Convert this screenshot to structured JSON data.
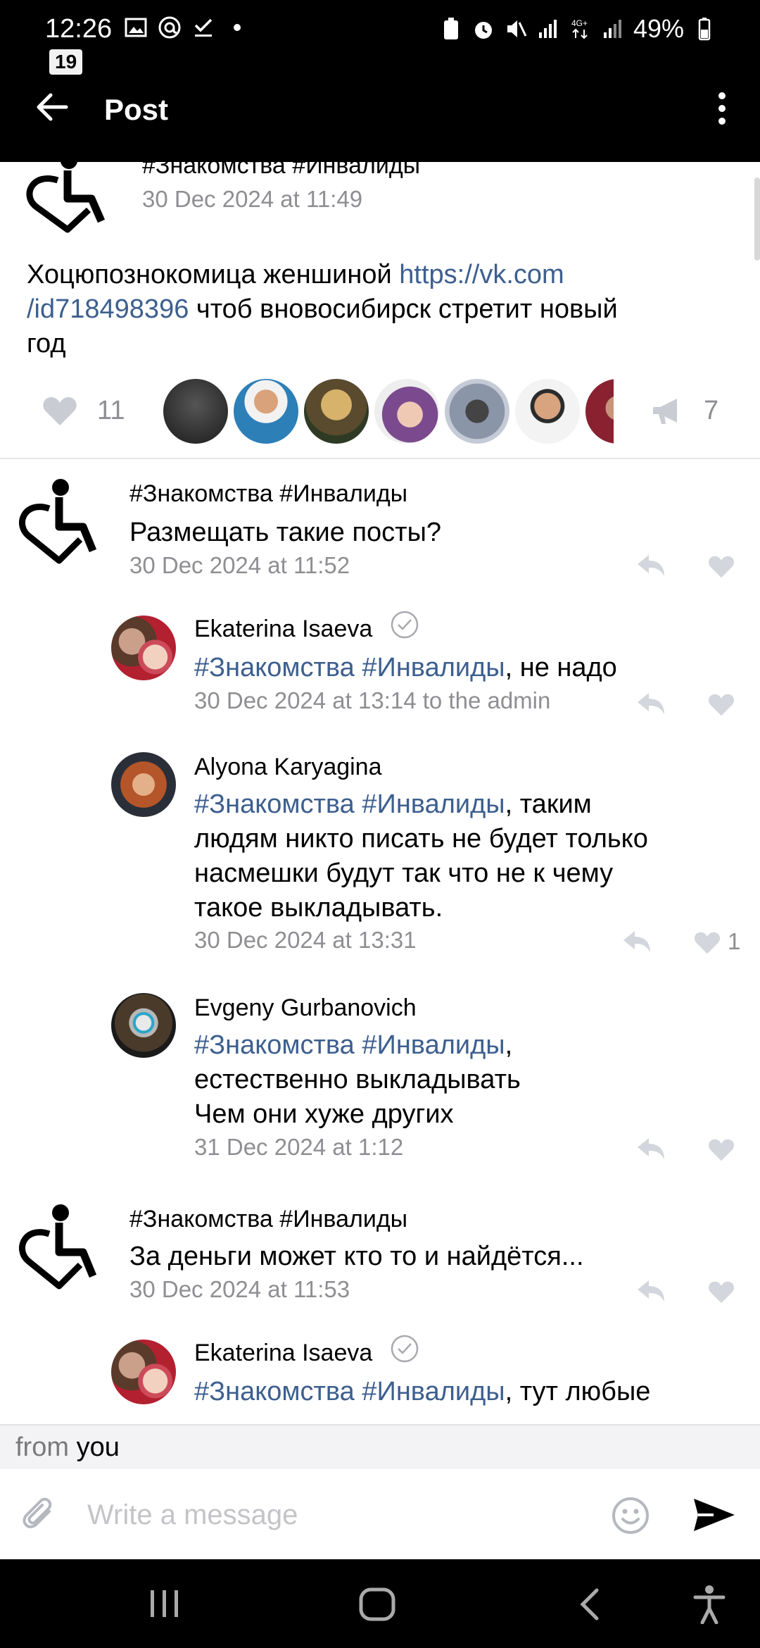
{
  "status_bar": {
    "time": "12:26",
    "battery": "49%"
  },
  "toolbar": {
    "title": "Post",
    "badge": "19"
  },
  "post": {
    "author": "#Знакомства #Инвалиды",
    "date": "30 Dec 2024 at 11:49",
    "text_before": "Хоцюпознокомица женшиной ",
    "link": "https://vk.com/id718498396",
    "link_line1": "https://vk.com",
    "link_line2": "/id718498396",
    "text_after_line2": " чтоб вновосибирск стретит новый",
    "text_line3": "год",
    "likes": "11",
    "reposts": "7"
  },
  "comments": [
    {
      "author": "#Знакомства #Инвалиды",
      "text": "Размещать такие посты?",
      "date": "30 Dec 2024 at 11:52"
    },
    {
      "author": "Ekaterina Isaeva",
      "mention": "#Знакомства #Инвалиды",
      "text": ", не надо",
      "date": "30 Dec 2024 at 13:14 to the admin"
    },
    {
      "author": "Alyona Karyagina",
      "mention": "#Знакомства #Инвалиды",
      "text_l1": ", таким",
      "text_l2": "людям никто писать не будет только",
      "text_l3": "насмешки будут так что не к чему",
      "text_l4": "такое выкладывать.",
      "date": "30 Dec 2024 at 13:31",
      "likes": "1"
    },
    {
      "author": "Evgeny Gurbanovich",
      "mention": "#Знакомства #Инвалиды",
      "text_l1": ",",
      "text_l2": "естественно выкладывать",
      "text_l3": "Чем они хуже других",
      "date": "31 Dec 2024 at 1:12"
    },
    {
      "author": "#Знакомства #Инвалиды",
      "text": "За деньги может кто то и найдётся...",
      "date": "30 Dec 2024 at 11:53"
    },
    {
      "author": "Ekaterina Isaeva",
      "mention": "#Знакомства #Инвалиды",
      "text": ", тут любые"
    }
  ],
  "composer": {
    "from_label": "from",
    "from_user": "you",
    "placeholder": "Write a message"
  },
  "colors": {
    "link": "#3d5f8f",
    "muted": "#8e8e93",
    "icon_muted": "#c9ccd3"
  }
}
